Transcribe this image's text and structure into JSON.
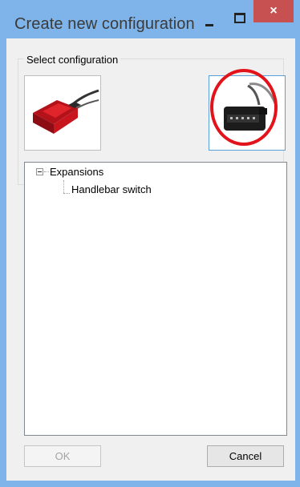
{
  "window": {
    "title": "Create new configuration",
    "controls": {
      "minimize_icon": "minimize-icon",
      "maximize_icon": "maximize-icon",
      "close_glyph": "×",
      "close_color": "#c75050"
    },
    "frame_color": "#7eb4ea"
  },
  "select_configuration": {
    "label": "Select configuration",
    "options": [
      {
        "name": "red-control-unit",
        "selected": false
      },
      {
        "name": "handlebar-switch-module",
        "selected": true
      }
    ]
  },
  "tree": {
    "root": {
      "label": "Expansions",
      "expanded": true
    },
    "children": [
      {
        "label": "Handlebar switch"
      }
    ]
  },
  "buttons": {
    "ok_label": "OK",
    "ok_enabled": false,
    "cancel_label": "Cancel"
  },
  "annotation": {
    "shape": "ellipse",
    "color": "#e3131b"
  }
}
